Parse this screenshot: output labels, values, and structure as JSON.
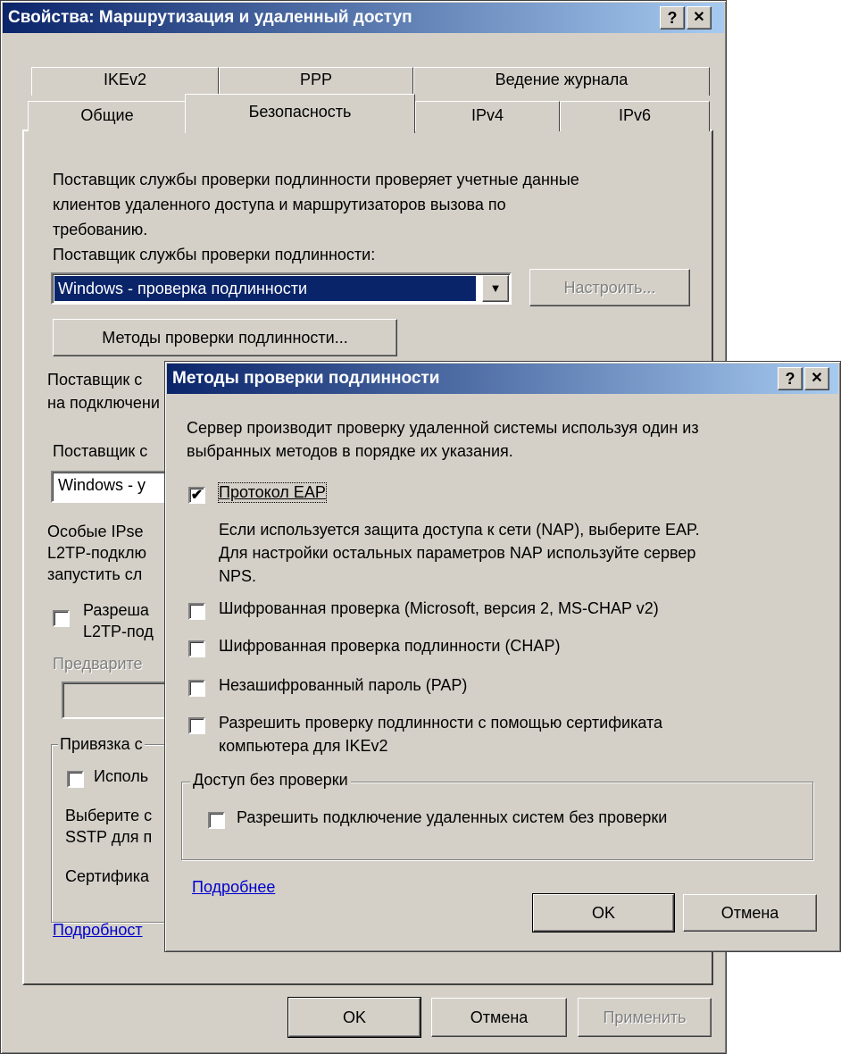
{
  "main": {
    "title": "Свойства: Маршрутизация и удаленный доступ",
    "help": "?",
    "close": "✕",
    "tabs_back": [
      "IKEv2",
      "PPP",
      "Ведение журнала"
    ],
    "tabs_front": [
      "Общие",
      "Безопасность",
      "IPv4",
      "IPv6"
    ],
    "intro_1": "Поставщик службы проверки подлинности проверяет учетные данные",
    "intro_2": "клиентов удаленного доступа и маршрутизаторов вызова по",
    "intro_3": "требованию.",
    "provider_label_a": "Поставщик службы проверки подлинности:",
    "provider_value": "Windows - проверка подлинности",
    "configure_label": "Настроить...",
    "methods_button": "Методы проверки подлинности...",
    "acc_1": "Поставщик с",
    "acc_2": "на подключени",
    "acc_label": "Поставщик с",
    "acc_value": "Windows - у",
    "ipsec_1": "Особые IPse",
    "ipsec_2": "L2TP-подклю",
    "ipsec_3": "запустить сл",
    "allow_l2tp_1": "Разреша",
    "allow_l2tp_2": "L2TP-под",
    "preshared_label": "Предварите",
    "binding_label": "Привязка с",
    "use_label": "Исполь",
    "select_1": "Выберите с",
    "select_2": "SSTP для п",
    "cert_label": "Сертифика",
    "details_link": "Подробност",
    "ok": "OK",
    "cancel": "Отмена",
    "apply": "Применить"
  },
  "dialog": {
    "title": "Методы проверки подлинности",
    "help": "?",
    "close": "✕",
    "desc_1": "Сервер производит проверку удаленной системы используя один из",
    "desc_2": "выбранных методов в порядке их указания.",
    "eap_label": "Протокол EAP",
    "eap_checked": true,
    "eap_note_1": "Если используется защита доступа к сети (NAP), выберите EAP.",
    "eap_note_2": "Для настройки остальных параметров NAP используйте сервер",
    "eap_note_3": "NPS.",
    "mschap_label": "Шифрованная проверка (Microsoft, версия 2, MS-CHAP v2)",
    "chap_label": "Шифрованная проверка подлинности (CHAP)",
    "pap_label": "Незашифрованный пароль (PAP)",
    "cert_label_1": "Разрешить проверку подлинности с помощью сертификата",
    "cert_label_2": "компьютера для IKEv2",
    "group_label": "Доступ без проверки",
    "noauth_label": "Разрешить подключение удаленных систем без проверки",
    "more_link": "Подробнее",
    "ok": "OK",
    "cancel": "Отмена"
  },
  "colors": {
    "face": "#d4d0c8",
    "title_start": "#0a246a",
    "title_end": "#a6caf0",
    "link": "#0000cc",
    "selection": "#0a246a"
  }
}
